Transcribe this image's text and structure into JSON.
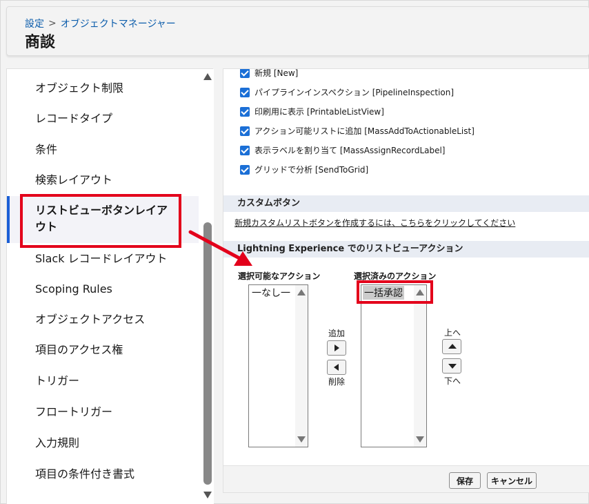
{
  "header": {
    "breadcrumb": [
      "設定",
      "オブジェクトマネージャー"
    ],
    "breadcrumb_separator": ">",
    "title": "商談"
  },
  "sidebar": {
    "items": [
      {
        "label": "オブジェクト制限",
        "active": false
      },
      {
        "label": "レコードタイプ",
        "active": false
      },
      {
        "label": "条件",
        "active": false
      },
      {
        "label": "検索レイアウト",
        "active": false
      },
      {
        "label": "リストビューボタンレイアウト",
        "line1": "リストビューボタンレイア",
        "line2": "ウト",
        "active": true
      },
      {
        "label": "Slack レコードレイアウト",
        "active": false
      },
      {
        "label": "Scoping Rules",
        "active": false
      },
      {
        "label": "オブジェクトアクセス",
        "active": false
      },
      {
        "label": "項目のアクセス権",
        "active": false
      },
      {
        "label": "トリガー",
        "active": false
      },
      {
        "label": "フロートリガー",
        "active": false
      },
      {
        "label": "入力規則",
        "active": false
      },
      {
        "label": "項目の条件付き書式",
        "active": false
      }
    ]
  },
  "standard_buttons": [
    {
      "label": "新規 [New]",
      "checked": true
    },
    {
      "label": "パイプラインインスペクション [PipelineInspection]",
      "checked": true
    },
    {
      "label": "印刷用に表示 [PrintableListView]",
      "checked": true
    },
    {
      "label": "アクション可能リストに追加 [MassAddToActionableList]",
      "checked": true
    },
    {
      "label": "表示ラベルを割り当て [MassAssignRecordLabel]",
      "checked": true
    },
    {
      "label": "グリッドで分析 [SendToGrid]",
      "checked": true
    }
  ],
  "custom_buttons": {
    "title": "カスタムボタン",
    "link": "新規カスタムリストボタンを作成するには、こちらをクリックしてください"
  },
  "lightning": {
    "title": "Lightning Experience でのリストビューアクション",
    "available_label": "選択可能なアクション",
    "available_options": [
      "一なし一"
    ],
    "selected_label": "選択済みのアクション",
    "selected_options": [
      "一括承認"
    ],
    "add_label": "追加",
    "remove_label": "削除",
    "up_label": "上へ",
    "down_label": "下へ"
  },
  "footer": {
    "save_label": "保存",
    "cancel_label": "キャンセル"
  },
  "colors": {
    "highlight": "#e3001b",
    "accent": "#1b6fd6",
    "link": "#0b5cab"
  }
}
